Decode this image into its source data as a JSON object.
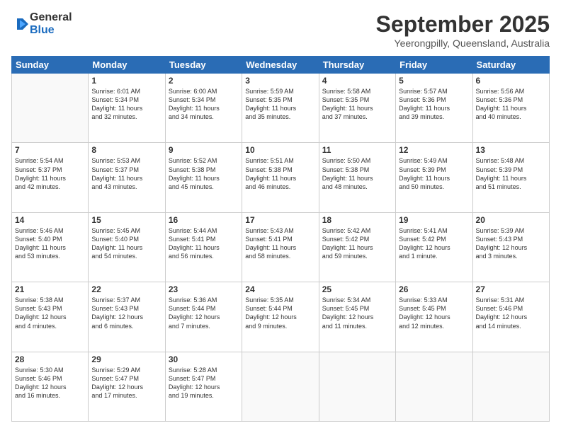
{
  "header": {
    "logo_line1": "General",
    "logo_line2": "Blue",
    "month": "September 2025",
    "location": "Yeerongpilly, Queensland, Australia"
  },
  "days_of_week": [
    "Sunday",
    "Monday",
    "Tuesday",
    "Wednesday",
    "Thursday",
    "Friday",
    "Saturday"
  ],
  "weeks": [
    [
      {
        "date": "",
        "info": ""
      },
      {
        "date": "1",
        "info": "Sunrise: 6:01 AM\nSunset: 5:34 PM\nDaylight: 11 hours\nand 32 minutes."
      },
      {
        "date": "2",
        "info": "Sunrise: 6:00 AM\nSunset: 5:34 PM\nDaylight: 11 hours\nand 34 minutes."
      },
      {
        "date": "3",
        "info": "Sunrise: 5:59 AM\nSunset: 5:35 PM\nDaylight: 11 hours\nand 35 minutes."
      },
      {
        "date": "4",
        "info": "Sunrise: 5:58 AM\nSunset: 5:35 PM\nDaylight: 11 hours\nand 37 minutes."
      },
      {
        "date": "5",
        "info": "Sunrise: 5:57 AM\nSunset: 5:36 PM\nDaylight: 11 hours\nand 39 minutes."
      },
      {
        "date": "6",
        "info": "Sunrise: 5:56 AM\nSunset: 5:36 PM\nDaylight: 11 hours\nand 40 minutes."
      }
    ],
    [
      {
        "date": "7",
        "info": "Sunrise: 5:54 AM\nSunset: 5:37 PM\nDaylight: 11 hours\nand 42 minutes."
      },
      {
        "date": "8",
        "info": "Sunrise: 5:53 AM\nSunset: 5:37 PM\nDaylight: 11 hours\nand 43 minutes."
      },
      {
        "date": "9",
        "info": "Sunrise: 5:52 AM\nSunset: 5:38 PM\nDaylight: 11 hours\nand 45 minutes."
      },
      {
        "date": "10",
        "info": "Sunrise: 5:51 AM\nSunset: 5:38 PM\nDaylight: 11 hours\nand 46 minutes."
      },
      {
        "date": "11",
        "info": "Sunrise: 5:50 AM\nSunset: 5:38 PM\nDaylight: 11 hours\nand 48 minutes."
      },
      {
        "date": "12",
        "info": "Sunrise: 5:49 AM\nSunset: 5:39 PM\nDaylight: 11 hours\nand 50 minutes."
      },
      {
        "date": "13",
        "info": "Sunrise: 5:48 AM\nSunset: 5:39 PM\nDaylight: 11 hours\nand 51 minutes."
      }
    ],
    [
      {
        "date": "14",
        "info": "Sunrise: 5:46 AM\nSunset: 5:40 PM\nDaylight: 11 hours\nand 53 minutes."
      },
      {
        "date": "15",
        "info": "Sunrise: 5:45 AM\nSunset: 5:40 PM\nDaylight: 11 hours\nand 54 minutes."
      },
      {
        "date": "16",
        "info": "Sunrise: 5:44 AM\nSunset: 5:41 PM\nDaylight: 11 hours\nand 56 minutes."
      },
      {
        "date": "17",
        "info": "Sunrise: 5:43 AM\nSunset: 5:41 PM\nDaylight: 11 hours\nand 58 minutes."
      },
      {
        "date": "18",
        "info": "Sunrise: 5:42 AM\nSunset: 5:42 PM\nDaylight: 11 hours\nand 59 minutes."
      },
      {
        "date": "19",
        "info": "Sunrise: 5:41 AM\nSunset: 5:42 PM\nDaylight: 12 hours\nand 1 minute."
      },
      {
        "date": "20",
        "info": "Sunrise: 5:39 AM\nSunset: 5:43 PM\nDaylight: 12 hours\nand 3 minutes."
      }
    ],
    [
      {
        "date": "21",
        "info": "Sunrise: 5:38 AM\nSunset: 5:43 PM\nDaylight: 12 hours\nand 4 minutes."
      },
      {
        "date": "22",
        "info": "Sunrise: 5:37 AM\nSunset: 5:43 PM\nDaylight: 12 hours\nand 6 minutes."
      },
      {
        "date": "23",
        "info": "Sunrise: 5:36 AM\nSunset: 5:44 PM\nDaylight: 12 hours\nand 7 minutes."
      },
      {
        "date": "24",
        "info": "Sunrise: 5:35 AM\nSunset: 5:44 PM\nDaylight: 12 hours\nand 9 minutes."
      },
      {
        "date": "25",
        "info": "Sunrise: 5:34 AM\nSunset: 5:45 PM\nDaylight: 12 hours\nand 11 minutes."
      },
      {
        "date": "26",
        "info": "Sunrise: 5:33 AM\nSunset: 5:45 PM\nDaylight: 12 hours\nand 12 minutes."
      },
      {
        "date": "27",
        "info": "Sunrise: 5:31 AM\nSunset: 5:46 PM\nDaylight: 12 hours\nand 14 minutes."
      }
    ],
    [
      {
        "date": "28",
        "info": "Sunrise: 5:30 AM\nSunset: 5:46 PM\nDaylight: 12 hours\nand 16 minutes."
      },
      {
        "date": "29",
        "info": "Sunrise: 5:29 AM\nSunset: 5:47 PM\nDaylight: 12 hours\nand 17 minutes."
      },
      {
        "date": "30",
        "info": "Sunrise: 5:28 AM\nSunset: 5:47 PM\nDaylight: 12 hours\nand 19 minutes."
      },
      {
        "date": "",
        "info": ""
      },
      {
        "date": "",
        "info": ""
      },
      {
        "date": "",
        "info": ""
      },
      {
        "date": "",
        "info": ""
      }
    ]
  ]
}
